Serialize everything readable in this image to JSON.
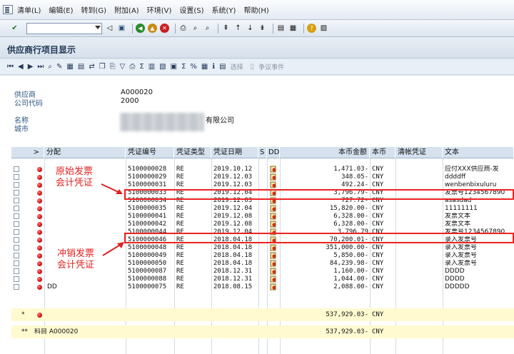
{
  "menu": [
    "清单(L)",
    "编辑(E)",
    "转到(G)",
    "附加(A)",
    "环境(V)",
    "设置(S)",
    "系统(Y)",
    "帮助(H)"
  ],
  "title": "供应商行项目显示",
  "appbar": {
    "select_label": "选择",
    "dispute_label": "争议事件"
  },
  "header": {
    "vendor_label": "供应商",
    "vendor_value": "A000020",
    "company_label": "公司代码",
    "company_value": "2000",
    "name_label": "名称",
    "name_value_visible": "有限公司",
    "city_label": "城市"
  },
  "columns": [
    "分配",
    "凭证编号",
    "凭证类型",
    "凭证日期",
    "S",
    "DD",
    "本币金额",
    "本币",
    "清帐凭证",
    "文本"
  ],
  "rows": [
    {
      "assign": "",
      "doc": "5100000028",
      "type": "RE",
      "date": "2019.10.12",
      "amount": "1,471.03-",
      "cur": "CNY",
      "text": "应付XXX供应商-发"
    },
    {
      "assign": "",
      "doc": "5100000029",
      "type": "RE",
      "date": "2019.12.03",
      "amount": "348.05-",
      "cur": "CNY",
      "text": "ddddff"
    },
    {
      "assign": "",
      "doc": "5100000031",
      "type": "RE",
      "date": "2019.12.03",
      "amount": "492.24-",
      "cur": "CNY",
      "text": "wenbenbixuluru"
    },
    {
      "assign": "",
      "doc": "5100000033",
      "type": "RE",
      "date": "2019.12.04",
      "amount": "3,796.79-",
      "cur": "CNY",
      "text": "发票号1234567890"
    },
    {
      "assign": "",
      "doc": "5100000034",
      "type": "RE",
      "date": "2019.12.03",
      "amount": "727.72-",
      "cur": "CNY",
      "text": "asasdad"
    },
    {
      "assign": "",
      "doc": "5100000035",
      "type": "RE",
      "date": "2019.12.04",
      "amount": "15,820.00-",
      "cur": "CNY",
      "text": "11111111"
    },
    {
      "assign": "",
      "doc": "5100000041",
      "type": "RE",
      "date": "2019.12.08",
      "amount": "6,328.00-",
      "cur": "CNY",
      "text": "发票文本"
    },
    {
      "assign": "",
      "doc": "5100000042",
      "type": "RE",
      "date": "2019.12.08",
      "amount": "6,328.00-",
      "cur": "CNY",
      "text": "发票文本"
    },
    {
      "assign": "",
      "doc": "5100000044",
      "type": "RE",
      "date": "2019.12.04",
      "amount": "3,796.79",
      "cur": "CNY",
      "text": "发票号1234567890"
    },
    {
      "assign": "",
      "doc": "5100000046",
      "type": "RE",
      "date": "2018.04.18",
      "amount": "70,200.01-",
      "cur": "CNY",
      "text": "录入发票号"
    },
    {
      "assign": "",
      "doc": "5100000048",
      "type": "RE",
      "date": "2018.04.18",
      "amount": "351,000.00-",
      "cur": "CNY",
      "text": "录入发票号"
    },
    {
      "assign": "",
      "doc": "5100000049",
      "type": "RE",
      "date": "2018.04.18",
      "amount": "5,850.00-",
      "cur": "CNY",
      "text": "录入发票号"
    },
    {
      "assign": "",
      "doc": "5100000050",
      "type": "RE",
      "date": "2018.04.18",
      "amount": "84,239.98-",
      "cur": "CNY",
      "text": "录入发票号"
    },
    {
      "assign": "",
      "doc": "5100000087",
      "type": "RE",
      "date": "2018.12.31",
      "amount": "1,160.00-",
      "cur": "CNY",
      "text": "DDDD"
    },
    {
      "assign": "",
      "doc": "5100000088",
      "type": "RE",
      "date": "2018.12.31",
      "amount": "1,044.00-",
      "cur": "CNY",
      "text": "DDDD"
    },
    {
      "assign": "DD",
      "doc": "5100000075",
      "type": "RE",
      "date": "2018.08.15",
      "amount": "2,088.00-",
      "cur": "CNY",
      "text": "DDDDD"
    }
  ],
  "sum_row": {
    "marker": "*",
    "amount": "537,929.03-",
    "cur": "CNY"
  },
  "total_row": {
    "marker": "**",
    "label": "科目 A000020",
    "amount": "537,929.03-",
    "cur": "CNY"
  },
  "annotations": {
    "original": [
      "原始发票",
      "会计凭证"
    ],
    "reversal": [
      "冲销发票",
      "会计凭证"
    ]
  },
  "colors": {
    "highlight": "#e22222",
    "annotation": "#e02020",
    "header_bg": "#d5e1ee",
    "sum_bg": "#fffad0"
  }
}
